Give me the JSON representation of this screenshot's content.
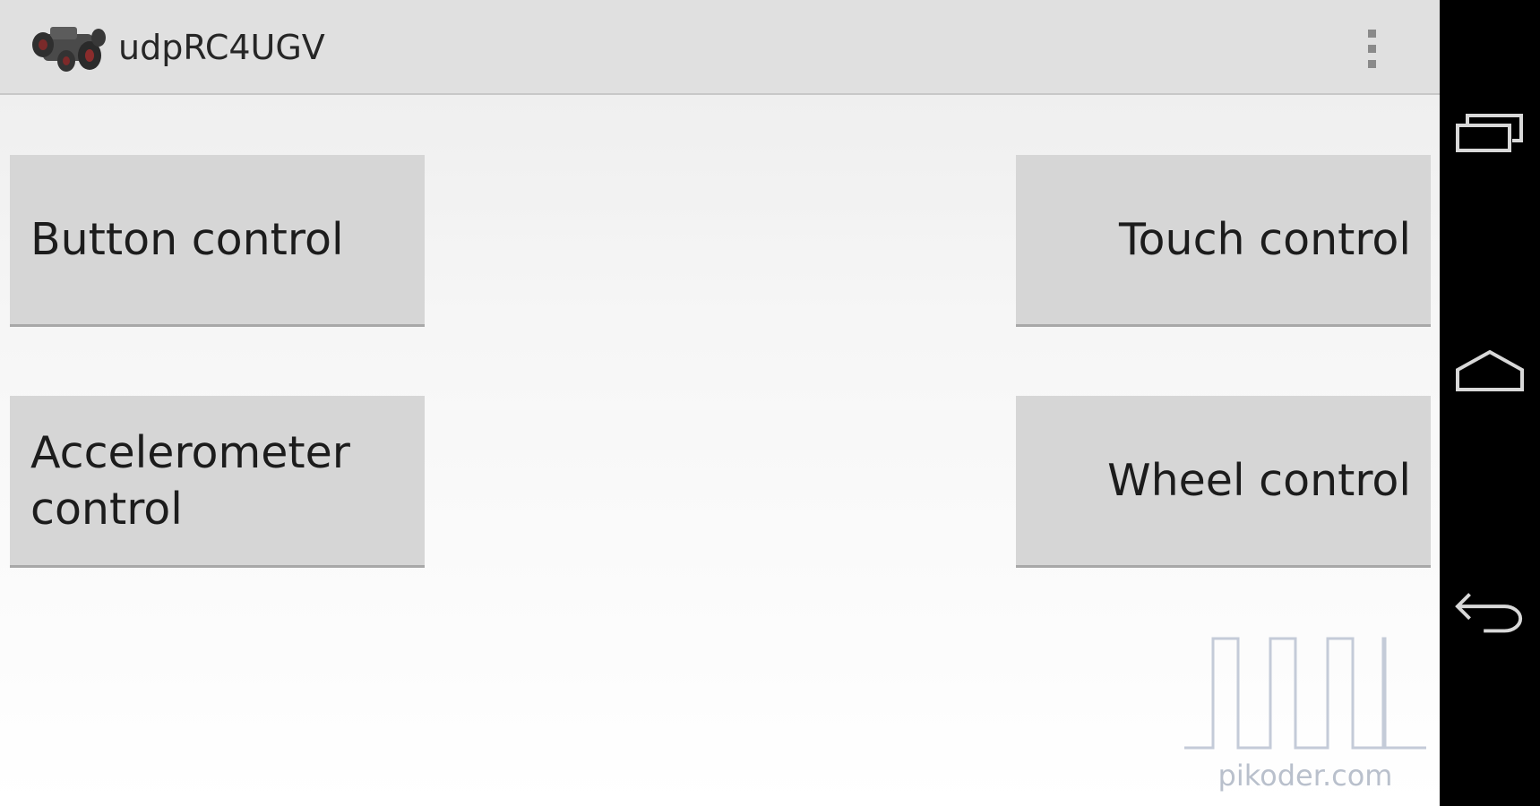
{
  "action_bar": {
    "title": "udpRC4UGV",
    "app_icon": "robot-vehicle-icon",
    "overflow_icon": "overflow-menu-icon"
  },
  "controls": {
    "button_control": "Button control",
    "touch_control": "Touch control",
    "accelerometer_control": "Accelerometer control",
    "wheel_control": "Wheel control"
  },
  "watermark": {
    "text": "pikoder.com",
    "icon": "pwm-pulse-icon"
  },
  "nav_bar": {
    "recent_apps_icon": "recent-apps-icon",
    "home_icon": "home-icon",
    "back_icon": "back-icon"
  },
  "colors": {
    "action_bar_bg": "#e0e0e0",
    "button_bg": "#d6d6d6",
    "nav_bar_bg": "#000000",
    "watermark": "#b9c0cc"
  }
}
